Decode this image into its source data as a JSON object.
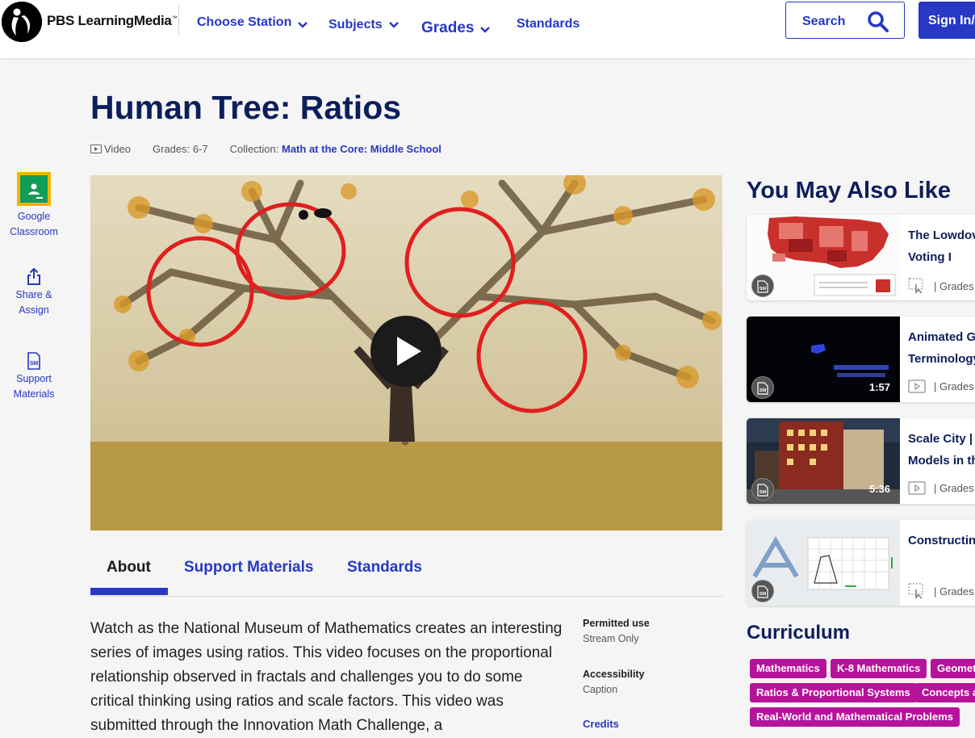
{
  "header": {
    "logo_text": "PBS LearningMedia",
    "logo_mark": "™",
    "nav": [
      {
        "label": "Choose Station",
        "has_dropdown": true
      },
      {
        "label": "Subjects",
        "has_dropdown": true
      },
      {
        "label": "Grades",
        "has_dropdown": true
      },
      {
        "label": "Standards",
        "has_dropdown": false
      }
    ],
    "search_label": "Search",
    "signin_label": "Sign In/U"
  },
  "page": {
    "title": "Human Tree: Ratios",
    "type": "Video",
    "grades": "Grades: 6-7",
    "collection_label": "Collection:",
    "collection": "Math at the Core: Middle School"
  },
  "rail": [
    {
      "line1": "Google",
      "line2": "Classroom",
      "icon": "google-classroom-icon"
    },
    {
      "line1": "Share &",
      "line2": "Assign",
      "icon": "share-icon"
    },
    {
      "line1": "Support",
      "line2": "Materials",
      "icon": "support-materials-icon"
    }
  ],
  "tabs": [
    {
      "label": "About",
      "active": true
    },
    {
      "label": "Support Materials",
      "active": false
    },
    {
      "label": "Standards",
      "active": false
    }
  ],
  "description": "Watch as the National Museum of Mathematics creates an interesting series of images using ratios. This video focuses on the proportional relationship observed in fractals and challenges you to do some critical thinking using ratios and scale factors. This video was submitted through the Innovation Math Challenge, a",
  "details": {
    "permitted_use_label": "Permitted use",
    "permitted_use": "Stream Only",
    "accessibility_label": "Accessibility",
    "accessibility": "Caption",
    "credits_label": "Credits"
  },
  "recommendations": {
    "heading": "You May Also Like",
    "items": [
      {
        "title": "The Lowdov and Voting I",
        "duration": "",
        "grades": "| Grades",
        "badge": "SM",
        "type_icon": "interactive-icon"
      },
      {
        "title": "Animated G Terminology",
        "duration": "1:57",
        "grades": "| Grades",
        "badge": "SM",
        "type_icon": "video-icon"
      },
      {
        "title": "Scale City | S Models in th",
        "duration": "5:36",
        "grades": "| Grades",
        "badge": "SM",
        "type_icon": "video-icon"
      },
      {
        "title": "Constructin",
        "duration": "",
        "grades": "| Grades",
        "badge": "SM",
        "type_icon": "interactive-icon"
      }
    ]
  },
  "curriculum": {
    "heading": "Curriculum",
    "tags": [
      "Mathematics",
      "K-8 Mathematics",
      "Geomet",
      "Ratios & Proportional Systems",
      "Concepts a",
      "Real-World and Mathematical Problems"
    ]
  },
  "colors": {
    "primary": "#2638c4",
    "heading": "#0c1e5b",
    "tag": "#b6139b",
    "background": "#f5f5f5"
  }
}
